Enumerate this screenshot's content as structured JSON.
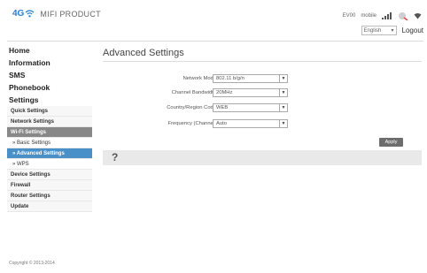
{
  "header": {
    "logo_text": "4G",
    "product_name": "MIFI PRODUCT",
    "operator": "EV00",
    "network": "mobile",
    "language_value": "English",
    "logout_label": "Logout"
  },
  "sidebar": {
    "top_items": [
      {
        "label": "Home"
      },
      {
        "label": "Information"
      },
      {
        "label": "SMS"
      },
      {
        "label": "Phonebook"
      },
      {
        "label": "Settings"
      }
    ],
    "sub_items": [
      {
        "label": "Quick Settings"
      },
      {
        "label": "Network Settings"
      },
      {
        "label": "Wi-Fi Settings"
      },
      {
        "label": "» Basic Settings"
      },
      {
        "label": "» Advanced Settings"
      },
      {
        "label": "» WPS"
      },
      {
        "label": "Device Settings"
      },
      {
        "label": "Firewall"
      },
      {
        "label": "Router Settings"
      },
      {
        "label": "Update"
      }
    ]
  },
  "main": {
    "title": "Advanced Settings",
    "fields": [
      {
        "label": "Network Mode",
        "value": "802.11 b/g/n"
      },
      {
        "label": "Channel Bandwidth",
        "value": "20MHz"
      },
      {
        "label": "Country/Region Code",
        "value": "WEB"
      },
      {
        "label": "Frequency (Channel)",
        "value": "Auto"
      }
    ],
    "apply_label": "Apply",
    "help_symbol": "?"
  },
  "footer": {
    "copyright": "Copyright © 2013-2014"
  },
  "colors": {
    "brand_blue": "#2a7fd0",
    "active_nav": "#4a90c8",
    "section_header": "#888888",
    "button": "#6d6d6d"
  }
}
